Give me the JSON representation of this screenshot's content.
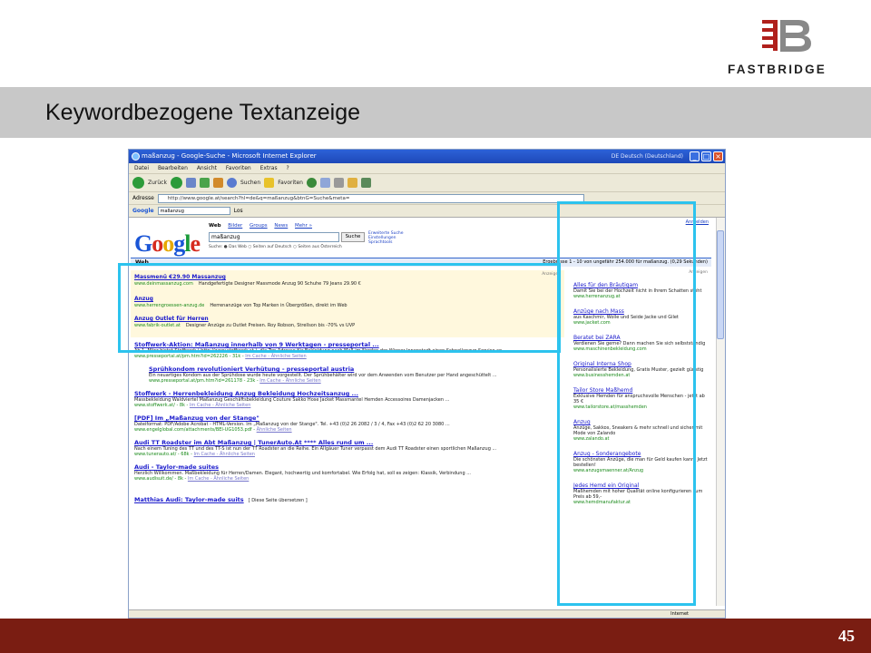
{
  "slide": {
    "title": "Keywordbezogene Textanzeige",
    "page_number": "45",
    "logo_text": "FASTBRIDGE"
  },
  "colors": {
    "title_band": "#c8c8c8",
    "footer": "#7a1d12",
    "highlight": "#2cc3ee"
  },
  "browser": {
    "window_title": "maßanzug - Google-Suche - Microsoft Internet Explorer",
    "language_indicator": "DE Deutsch (Deutschland)",
    "menu": [
      "Datei",
      "Bearbeiten",
      "Ansicht",
      "Favoriten",
      "Extras",
      "?"
    ],
    "toolbar": {
      "back_label": "Zurück",
      "search_label": "Suchen",
      "favorites_label": "Favoriten"
    },
    "address_label": "Adresse",
    "address_url": "http://www.google.at/search?hl=de&q=maßanzug&btnG=Suche&meta=",
    "googlebar": {
      "label": "Google",
      "query": "maßanzug",
      "go_label": "Los"
    },
    "status": {
      "zone": "Internet"
    }
  },
  "google": {
    "tabs": [
      "Web",
      "Bilder",
      "Groups",
      "News",
      "Mehr »"
    ],
    "active_tab": "Web",
    "search_value": "maßanzug",
    "search_button": "Suche",
    "advanced": [
      "Erweiterte Suche",
      "Einstellungen",
      "Sprachtools"
    ],
    "radio_text": "Suche: ● Das Web  ○ Seiten auf Deutsch  ○ Seiten aus Österreich",
    "preferences": "Anmelden",
    "webbar_label": "Web",
    "results_count": "Ergebnisse 1 - 10 von ungefähr 254.000 für maßanzug. (0,29 Sekunden)",
    "sponsored_label": "Anzeigen",
    "top_ads": [
      {
        "title": "Massmenü €29.90 Massanzug",
        "url": "www.deinmassanzug.com",
        "desc": "Handgefertigte Designer Massmode Anzug 90 Schuhe 79 Jeans 29.90 €"
      },
      {
        "title": "Anzug",
        "url": "www.herrengroessen-anzug.de",
        "desc": "Herrenanzüge von Top Marken in Übergrößen, direkt im Web"
      },
      {
        "title": "Anzug Outlet für Herren",
        "url": "www.fabrik-outlet.at",
        "desc": "Designer Anzüge zu Outlet Preisen. Roy Robson, Strellson bis -70% vs UVP"
      }
    ],
    "results": [
      {
        "title": "Stoffwerk-Aktion: Maßanzug innerhalb von 9 Werktagen - presseportal ...",
        "snippet": "Ab 1. März bietet Stoffwerk ( http://www.stoffwerk.at ), die Top-Adresse für Bekleidung nach Maß im Norden der Wiener Innenstadt einen Schnellanzug-Service an ...",
        "url": "www.presseportal.at/pm.htm?id=262226 - 31k -",
        "cache": "Im Cache - Ähnliche Seiten",
        "indent": false
      },
      {
        "title": "Sprühkondom revolutioniert Verhütung - presseportal austria",
        "snippet": "Ein neuartiges Kondom aus der Sprühdose wurde heute vorgestellt. Der Sprühbehälter wird vor dem Anwenden vom Benutzer per Hand angeschüttelt ...",
        "url": "www.presseportal.at/pm.htm?id=261178 - 23k -",
        "cache": "Im Cache - Ähnliche Seiten",
        "indent": true
      },
      {
        "title": "Stoffwerk - Herrenbekleidung Anzug Bekleidung Hochzeitsanzug ...",
        "snippet": "Massbekleidung Waldviertel Maßanzug Geschäftsbekleidung Couture Sakko Hose Jacket Massmantel Hemden Accessoires Damenjacken ...",
        "url": "www.stoffwerk.at/ - 8k -",
        "cache": "Im Cache - Ähnliche Seiten",
        "indent": false
      },
      {
        "title": "[PDF] Im „Maßanzug von der Stange\"",
        "snippet": "Dateiformat: PDF/Adobe Acrobat - HTML-Version. Im „Maßanzug von der Stange\". Tel. +43 (0)2 26 2082 / 3 / 4, Fax +43 (0)2 62 20 3080 ...",
        "url": "www.engelglobal.com/attachments/BEI-UG1053.pdf -",
        "cache": "Ähnliche Seiten",
        "indent": false
      },
      {
        "title": "Audi TT Roadster im Abt Maßanzug | TunerAuto.At **** Alles rund um ...",
        "snippet": "Nach einem Tuning des TT und des TT-S ist nun der TT Roadster an die Reihe. Ein Allgäuer Tuner verpasst dem Audi TT Roadster einen sportlichen Maßanzug ...",
        "url": "www.tunerauto.at/ - 68k -",
        "cache": "Im Cache - Ähnliche Seiten",
        "indent": false
      },
      {
        "title": "Audi - Taylor-made suites",
        "snippet": "Herzlich Willkommen. Maßbekleidung für Herren/Damen. Elegant, hochwertig und komfortabel. Wie Erfolg hat, soll es zeigen: Klassik, Verbindung ...",
        "url": "www.audisuit.de/ - 8k -",
        "cache": "Im Cache - Ähnliche Seiten",
        "indent": false
      },
      {
        "title": "Matthias Audi: Taylor-made suits",
        "snippet": "[ Diese Seite übersetzen ]",
        "url": "",
        "cache": "",
        "indent": false
      }
    ],
    "right_label": "Anzeigen",
    "right_ads": [
      {
        "title": "Alles für den Bräutigam",
        "desc": "Damit Sie bei der Hochzeit nicht in Ihrem Schatten steht",
        "url": "www.herrenanzug.at"
      },
      {
        "title": "Anzüge nach Mass",
        "desc": "aus Kaschmir, Wolle und Seide Jacke und Gilet",
        "url": "www.jacket.com"
      },
      {
        "title": "Beratet bei ZARA",
        "desc": "Verdienen Sie gerne? Dann machen Sie sich selbstständig",
        "url": "www.maschinenbekleidung.com"
      },
      {
        "title": "Original Interna Shop",
        "desc": "Personalisierte Bekleidung, Gratis Muster, gezielt günstig",
        "url": "www.businesshemden.at"
      },
      {
        "title": "Tailor Store Maßhemd",
        "desc": "Exklusive Hemden für anspruchsvolle Menschen - jetzt ab 35 €",
        "url": "www.tailorstore.at/masshemden"
      },
      {
        "title": "Anzug",
        "desc": "Anzüge, Sakkos, Sneakers & mehr schnell und sicher mit Mode von Zalando",
        "url": "www.zalando.at"
      },
      {
        "title": "Anzug - Sonderangebote",
        "desc": "Die schönsten Anzüge, die man für Geld kaufen kann. Jetzt bestellen!",
        "url": "www.anzugsmaenner.at/Anzug"
      },
      {
        "title": "Jedes Hemd ein Original",
        "desc": "Maßhemden mit hoher Qualität online konfigurieren zum Preis ab 59,-",
        "url": "www.hemdmanufaktur.at"
      }
    ]
  }
}
